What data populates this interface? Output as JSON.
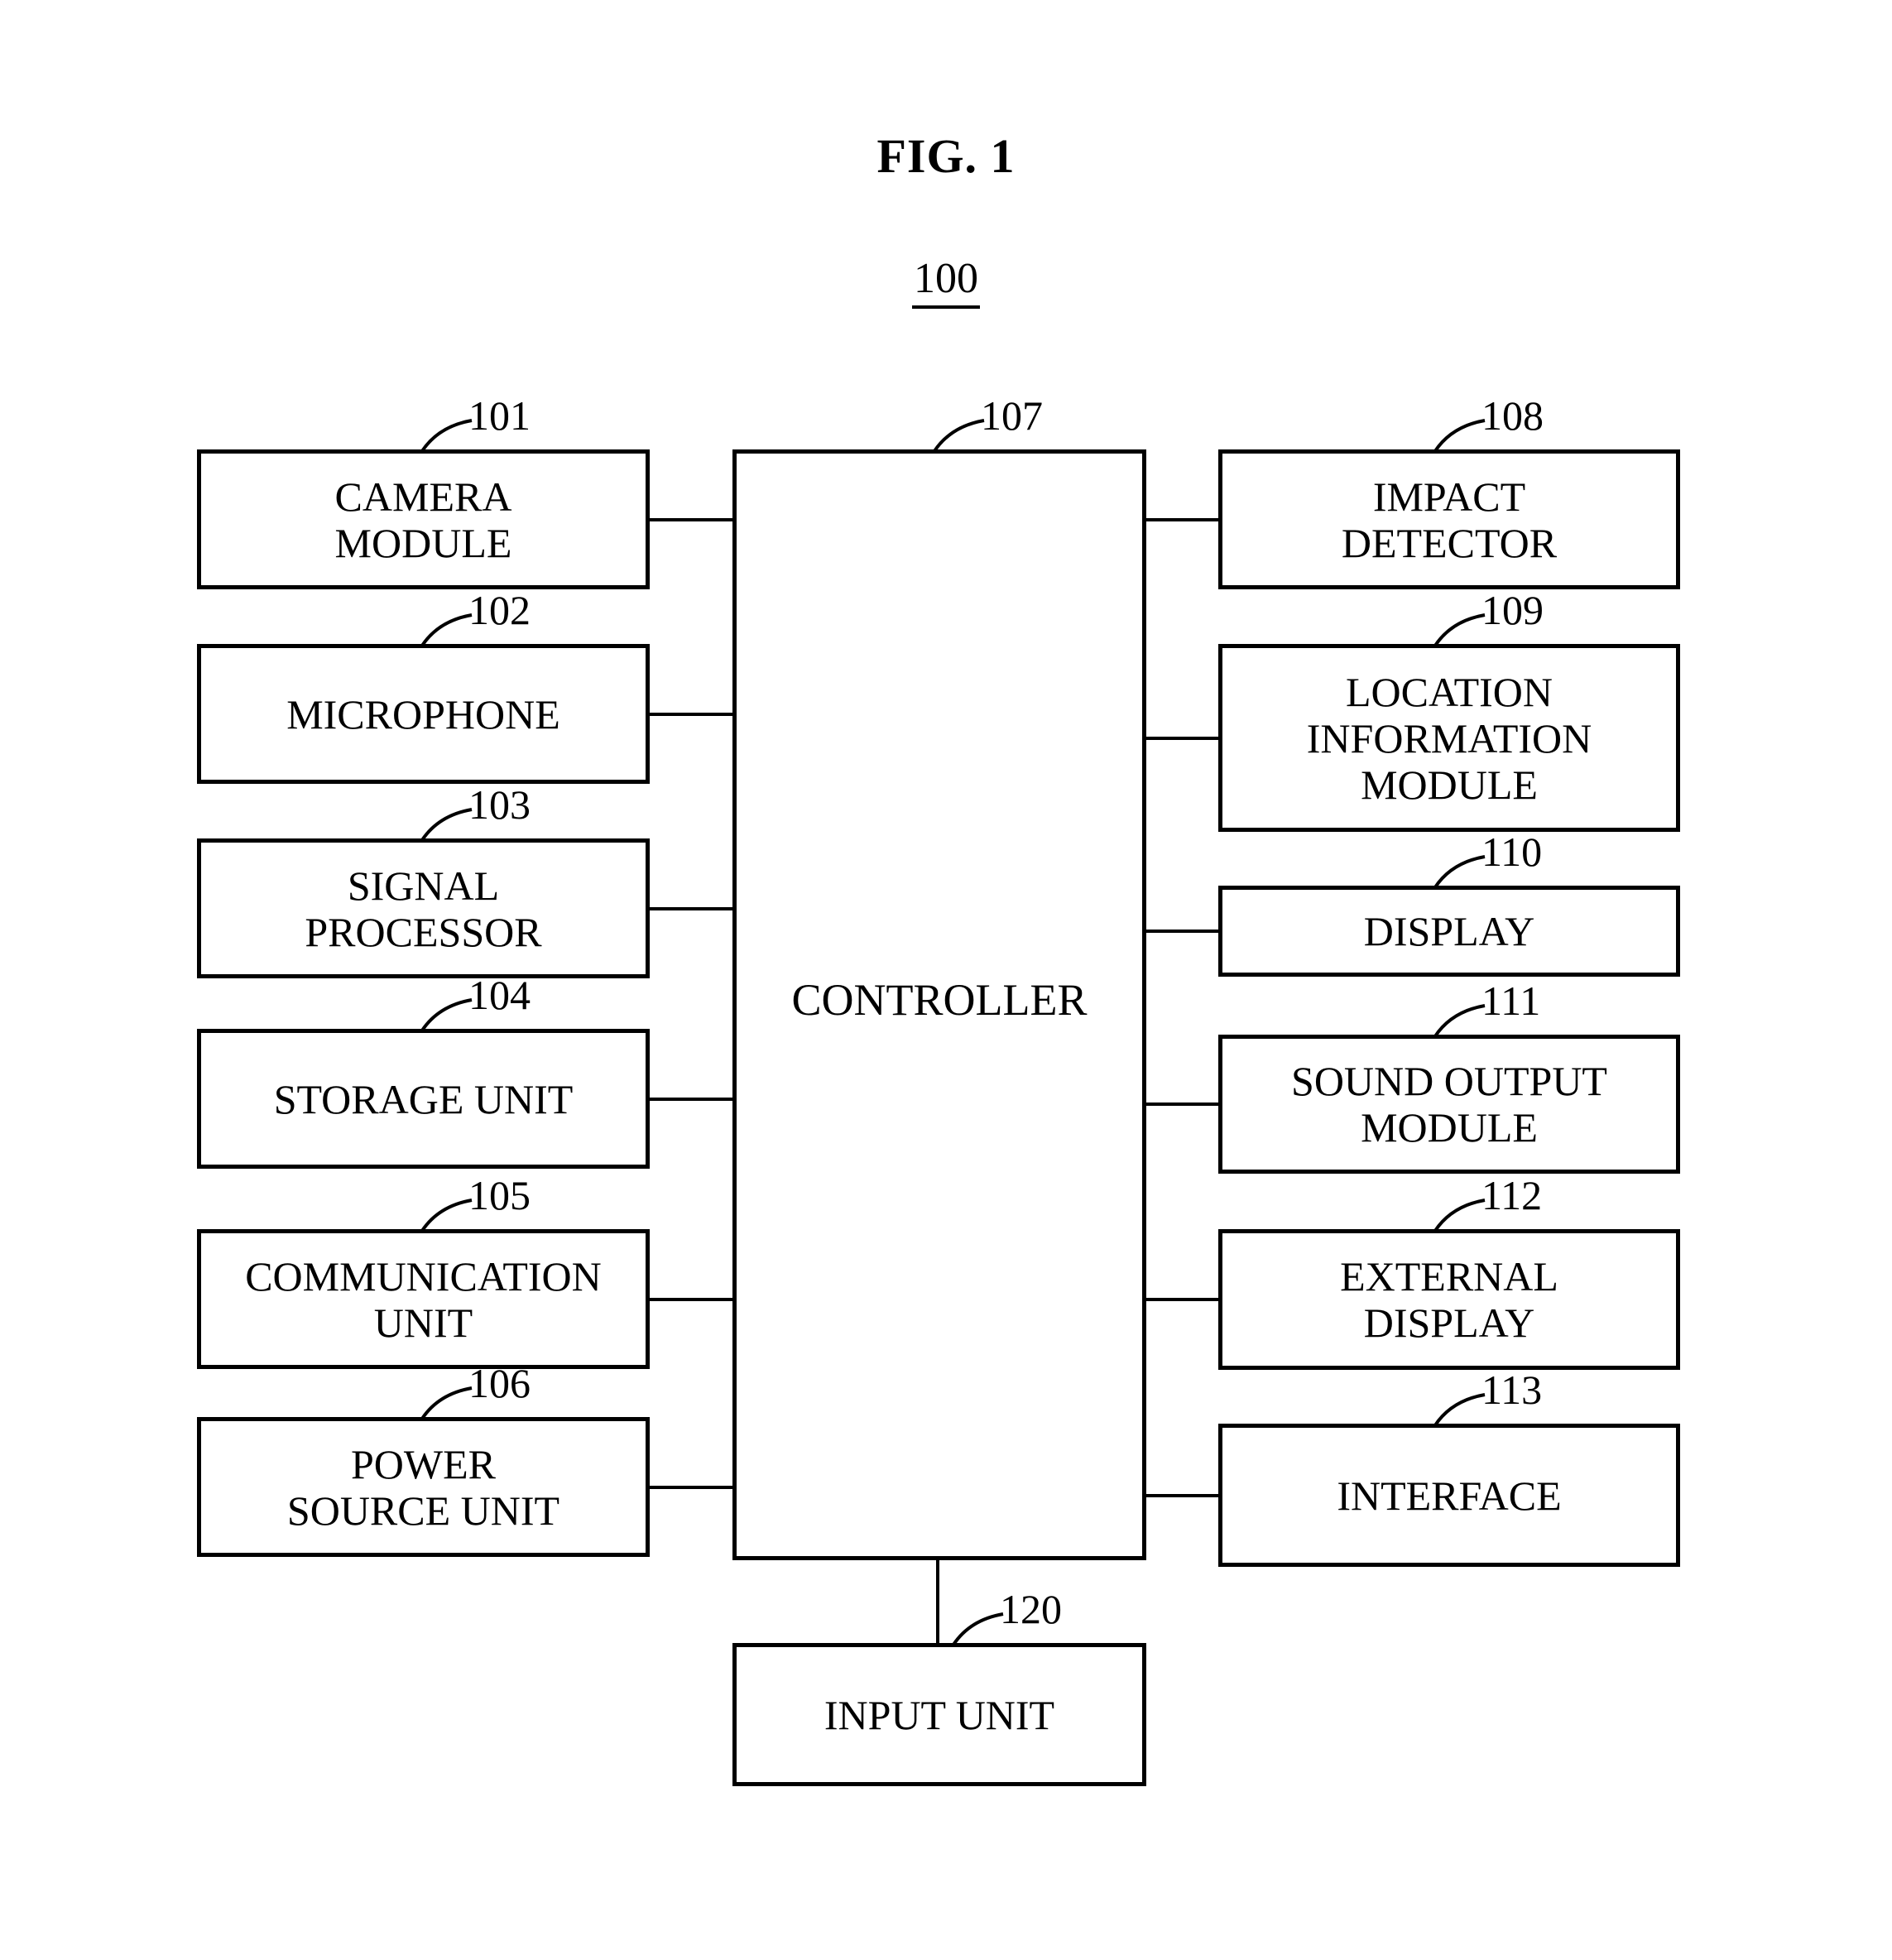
{
  "figure": {
    "title": "FIG. 1",
    "system_ref": "100"
  },
  "controller": {
    "label": "CONTROLLER",
    "ref": "107"
  },
  "input_unit": {
    "label": "INPUT UNIT",
    "ref": "120"
  },
  "left_blocks": [
    {
      "ref": "101",
      "label": "CAMERA\nMODULE",
      "lines": [
        "CAMERA",
        "MODULE"
      ]
    },
    {
      "ref": "102",
      "label": "MICROPHONE",
      "lines": [
        "MICROPHONE"
      ]
    },
    {
      "ref": "103",
      "label": "SIGNAL\nPROCESSOR",
      "lines": [
        "SIGNAL",
        "PROCESSOR"
      ]
    },
    {
      "ref": "104",
      "label": "STORAGE UNIT",
      "lines": [
        "STORAGE UNIT"
      ]
    },
    {
      "ref": "105",
      "label": "COMMUNICATION\nUNIT",
      "lines": [
        "COMMUNICATION",
        "UNIT"
      ]
    },
    {
      "ref": "106",
      "label": "POWER\nSOURCE UNIT",
      "lines": [
        "POWER",
        "SOURCE UNIT"
      ]
    }
  ],
  "right_blocks": [
    {
      "ref": "108",
      "label": "IMPACT\nDETECTOR",
      "lines": [
        "IMPACT",
        "DETECTOR"
      ]
    },
    {
      "ref": "109",
      "label": "LOCATION\nINFORMATION\nMODULE",
      "lines": [
        "LOCATION",
        "INFORMATION",
        "MODULE"
      ]
    },
    {
      "ref": "110",
      "label": "DISPLAY",
      "lines": [
        "DISPLAY"
      ]
    },
    {
      "ref": "111",
      "label": "SOUND OUTPUT\nMODULE",
      "lines": [
        "SOUND OUTPUT",
        "MODULE"
      ]
    },
    {
      "ref": "112",
      "label": "EXTERNAL\nDISPLAY",
      "lines": [
        "EXTERNAL",
        "DISPLAY"
      ]
    },
    {
      "ref": "113",
      "label": "INTERFACE",
      "lines": [
        "INTERFACE"
      ]
    }
  ],
  "colors": {
    "ink": "#000000",
    "paper": "#ffffff"
  }
}
